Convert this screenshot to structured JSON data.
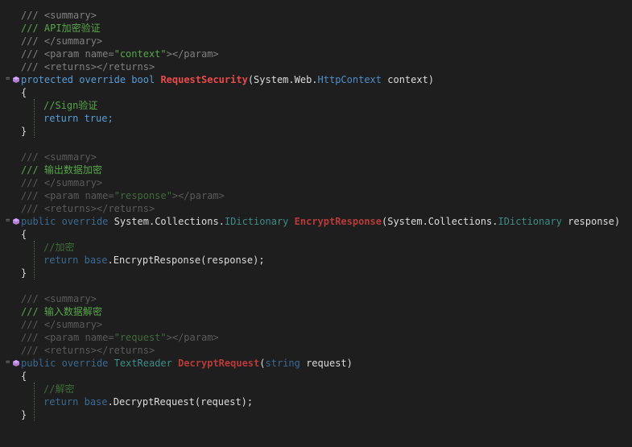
{
  "editor": {
    "block1": {
      "doc": {
        "summary_open": "/// <summary>",
        "summary_text": "/// API加密验证",
        "summary_close": "/// </summary>",
        "param_prefix": "/// <param name=",
        "param_name": "\"context\"",
        "param_suffix": "></param>",
        "returns": "/// <returns></returns>"
      },
      "signature": {
        "kw1": "protected",
        "kw2": "override",
        "kw3": "bool",
        "method": "RequestSecurity",
        "paren_open": "(",
        "param_ns": "System.Web.",
        "param_type": "HttpContext",
        "param_name": " context",
        "paren_close": ")"
      },
      "brace_open": "{",
      "comment": "//Sign验证",
      "return_kw": "return",
      "return_val": " true;",
      "brace_close": "}"
    },
    "block2": {
      "doc": {
        "summary_open": "/// <summary>",
        "summary_text": "/// 输出数据加密",
        "summary_close": "/// </summary>",
        "param_prefix": "/// <param name=",
        "param_name": "\"response\"",
        "param_suffix": "></param>",
        "returns": "/// <returns></returns>"
      },
      "signature": {
        "kw1": "public",
        "kw2": "override",
        "ret_ns": "System.Collections.",
        "ret_type": "IDictionary",
        "method": "EncryptResponse",
        "paren_open": "(",
        "param_ns": "System.Collections.",
        "param_type": "IDictionary",
        "param_name": " response",
        "paren_close": ")"
      },
      "brace_open": "{",
      "comment": "//加密",
      "return_kw": "return",
      "base_kw": "base",
      "call": ".EncryptResponse(response);",
      "brace_close": "}"
    },
    "block3": {
      "doc": {
        "summary_open": "/// <summary>",
        "summary_text": "/// 输入数据解密",
        "summary_close": "/// </summary>",
        "param_prefix": "/// <param name=",
        "param_name": "\"request\"",
        "param_suffix": "></param>",
        "returns": "/// <returns></returns>"
      },
      "signature": {
        "kw1": "public",
        "kw2": "override",
        "ret_type": "TextReader",
        "method": "DecryptRequest",
        "paren_open": "(",
        "param_kw": "string",
        "param_name": " request",
        "paren_close": ")"
      },
      "brace_open": "{",
      "comment": "//解密",
      "return_kw": "return",
      "base_kw": "base",
      "call": ".DecryptRequest(request);",
      "brace_close": "}"
    },
    "icons": {
      "collapse": "collapse-minus-icon",
      "member": "method-cube-icon"
    },
    "colors": {
      "background": "#1e1e1e",
      "keyword": "#569cd6",
      "type": "#4ec9b0",
      "method": "#e84a4a",
      "comment": "#57a64a",
      "xml_tag": "#808080",
      "plain": "#dcdcdc"
    }
  }
}
